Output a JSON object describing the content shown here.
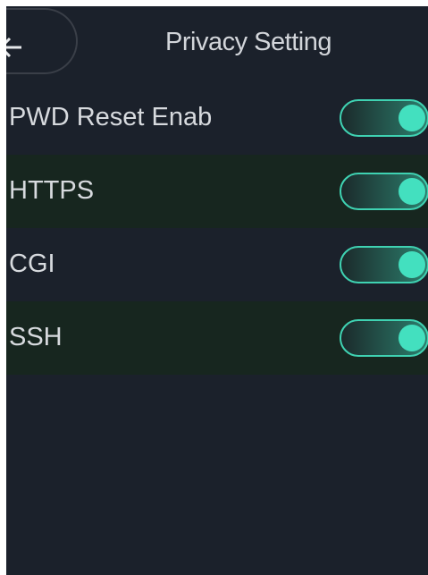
{
  "header": {
    "title": "Privacy Setting",
    "back_icon": "arrow-left-icon"
  },
  "settings": [
    {
      "label": "PWD Reset Enab",
      "enabled": true
    },
    {
      "label": "HTTPS",
      "enabled": true
    },
    {
      "label": "CGI",
      "enabled": true
    },
    {
      "label": "SSH",
      "enabled": true
    }
  ],
  "colors": {
    "background": "#1b212b",
    "alt_row": "#17261f",
    "accent": "#43e0bf",
    "text": "#d7dade"
  }
}
